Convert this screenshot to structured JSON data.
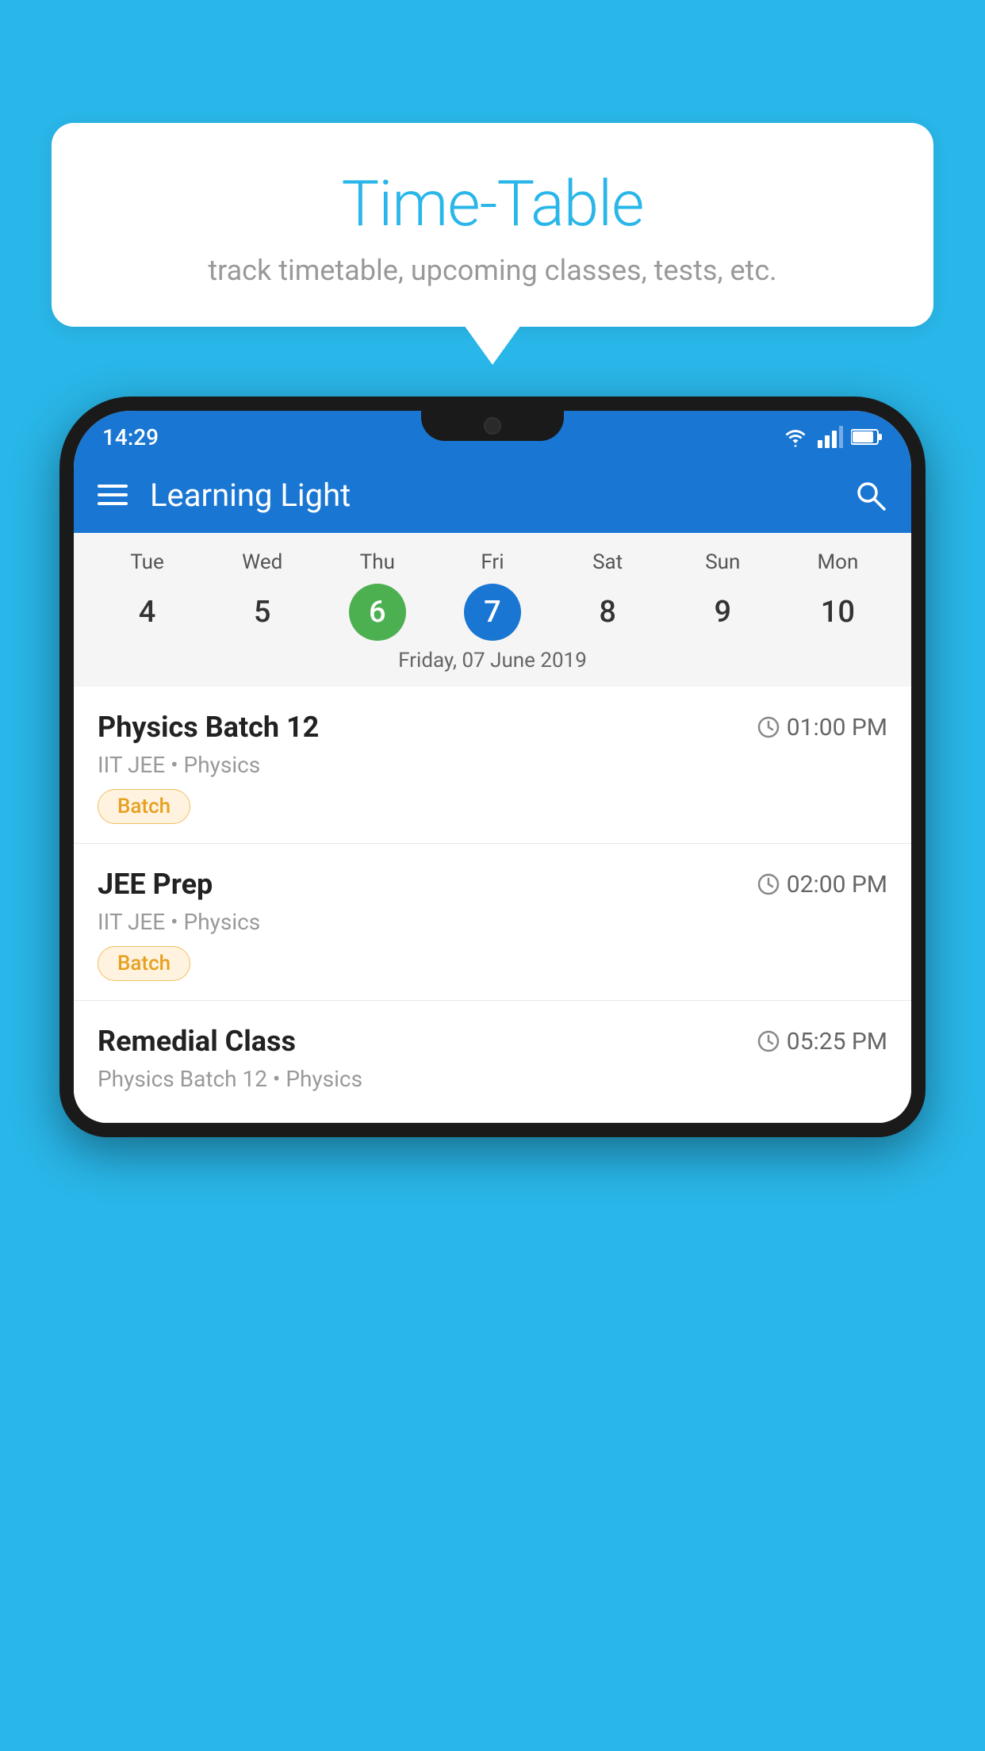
{
  "background_color": "#29b6e8",
  "bubble": {
    "title": "Time-Table",
    "subtitle": "track timetable, upcoming classes, tests, etc."
  },
  "phone": {
    "status_bar": {
      "time": "14:29"
    },
    "app_bar": {
      "title": "Learning Light"
    },
    "calendar": {
      "days": [
        "Tue",
        "Wed",
        "Thu",
        "Fri",
        "Sat",
        "Sun",
        "Mon"
      ],
      "numbers": [
        "4",
        "5",
        "6",
        "7",
        "8",
        "9",
        "10"
      ],
      "today_index": 2,
      "selected_index": 3,
      "selected_date_label": "Friday, 07 June 2019"
    },
    "schedule": [
      {
        "class_name": "Physics Batch 12",
        "time": "01:00 PM",
        "meta": "IIT JEE • Physics",
        "badge": "Batch"
      },
      {
        "class_name": "JEE Prep",
        "time": "02:00 PM",
        "meta": "IIT JEE • Physics",
        "badge": "Batch"
      },
      {
        "class_name": "Remedial Class",
        "time": "05:25 PM",
        "meta": "Physics Batch 12 • Physics",
        "badge": null
      }
    ]
  }
}
